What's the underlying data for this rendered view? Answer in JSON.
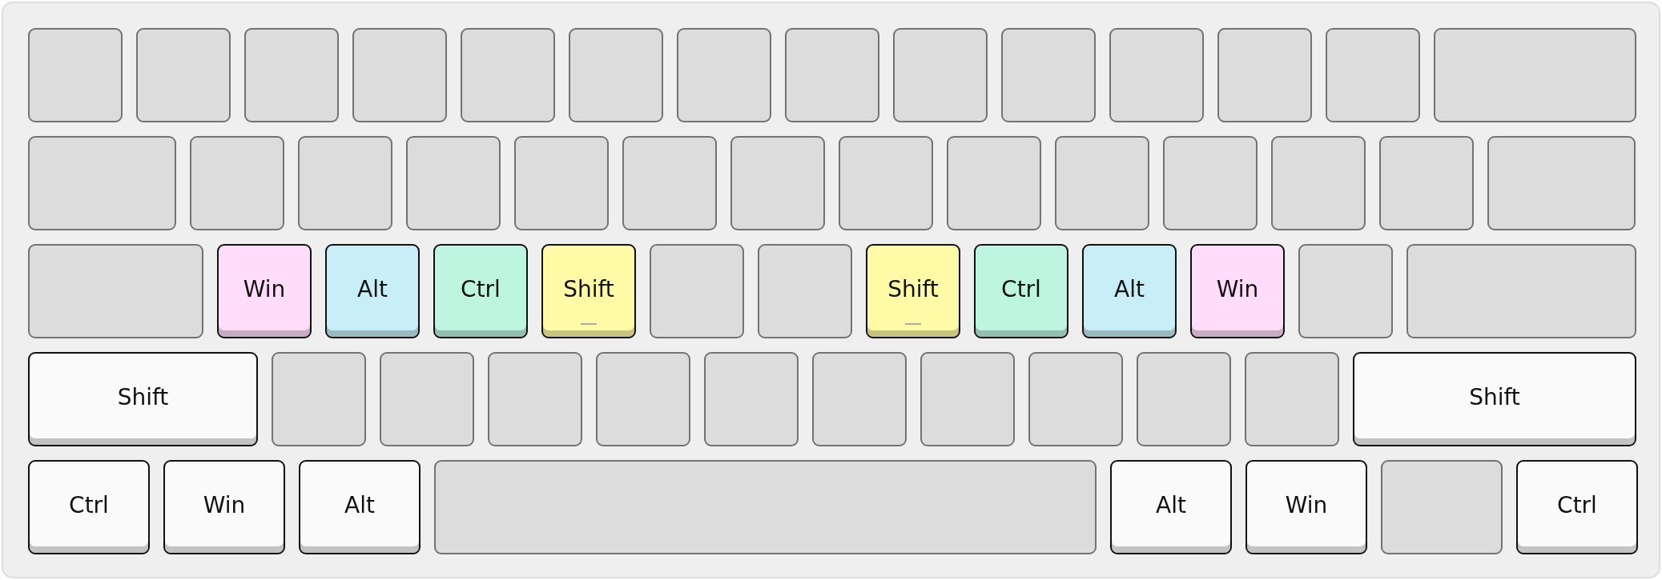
{
  "rows": [
    {
      "keys": [
        {
          "kind": "blank"
        },
        {
          "kind": "blank"
        },
        {
          "kind": "blank"
        },
        {
          "kind": "blank"
        },
        {
          "kind": "blank"
        },
        {
          "kind": "blank"
        },
        {
          "kind": "blank"
        },
        {
          "kind": "blank"
        },
        {
          "kind": "blank"
        },
        {
          "kind": "blank"
        },
        {
          "kind": "blank"
        },
        {
          "kind": "blank"
        },
        {
          "kind": "blank"
        },
        {
          "kind": "blank"
        }
      ]
    },
    {
      "keys": [
        {
          "kind": "blank"
        },
        {
          "kind": "blank"
        },
        {
          "kind": "blank"
        },
        {
          "kind": "blank"
        },
        {
          "kind": "blank"
        },
        {
          "kind": "blank"
        },
        {
          "kind": "blank"
        },
        {
          "kind": "blank"
        },
        {
          "kind": "blank"
        },
        {
          "kind": "blank"
        },
        {
          "kind": "blank"
        },
        {
          "kind": "blank"
        },
        {
          "kind": "blank"
        },
        {
          "kind": "blank"
        }
      ]
    },
    {
      "keys": [
        {
          "kind": "blank"
        },
        {
          "kind": "key",
          "label": "Win",
          "color": "#ffdcfa",
          "homing": false
        },
        {
          "kind": "key",
          "label": "Alt",
          "color": "#c8eef8",
          "homing": false
        },
        {
          "kind": "key",
          "label": "Ctrl",
          "color": "#bdf5e1",
          "homing": false
        },
        {
          "kind": "key",
          "label": "Shift",
          "color": "#fffaa6",
          "homing": true
        },
        {
          "kind": "blank"
        },
        {
          "kind": "blank"
        },
        {
          "kind": "key",
          "label": "Shift",
          "color": "#fffaa6",
          "homing": true
        },
        {
          "kind": "key",
          "label": "Ctrl",
          "color": "#bdf5e1",
          "homing": false
        },
        {
          "kind": "key",
          "label": "Alt",
          "color": "#c8eef8",
          "homing": false
        },
        {
          "kind": "key",
          "label": "Win",
          "color": "#ffdcfa",
          "homing": false
        },
        {
          "kind": "blank"
        },
        {
          "kind": "blank"
        }
      ]
    },
    {
      "keys": [
        {
          "kind": "key",
          "label": "Shift",
          "color": "#fafafa",
          "homing": false
        },
        {
          "kind": "blank"
        },
        {
          "kind": "blank"
        },
        {
          "kind": "blank"
        },
        {
          "kind": "blank"
        },
        {
          "kind": "blank"
        },
        {
          "kind": "blank"
        },
        {
          "kind": "blank"
        },
        {
          "kind": "blank"
        },
        {
          "kind": "blank"
        },
        {
          "kind": "blank"
        },
        {
          "kind": "key",
          "label": "Shift",
          "color": "#fafafa",
          "homing": false
        }
      ]
    },
    {
      "keys": [
        {
          "kind": "key",
          "label": "Ctrl",
          "color": "#fafafa",
          "homing": false
        },
        {
          "kind": "key",
          "label": "Win",
          "color": "#fafafa",
          "homing": false
        },
        {
          "kind": "key",
          "label": "Alt",
          "color": "#fafafa",
          "homing": false
        },
        {
          "kind": "blank"
        },
        {
          "kind": "key",
          "label": "Alt",
          "color": "#fafafa",
          "homing": false
        },
        {
          "kind": "key",
          "label": "Win",
          "color": "#fafafa",
          "homing": false
        },
        {
          "kind": "blank"
        },
        {
          "kind": "key",
          "label": "Ctrl",
          "color": "#fafafa",
          "homing": false
        }
      ]
    }
  ]
}
